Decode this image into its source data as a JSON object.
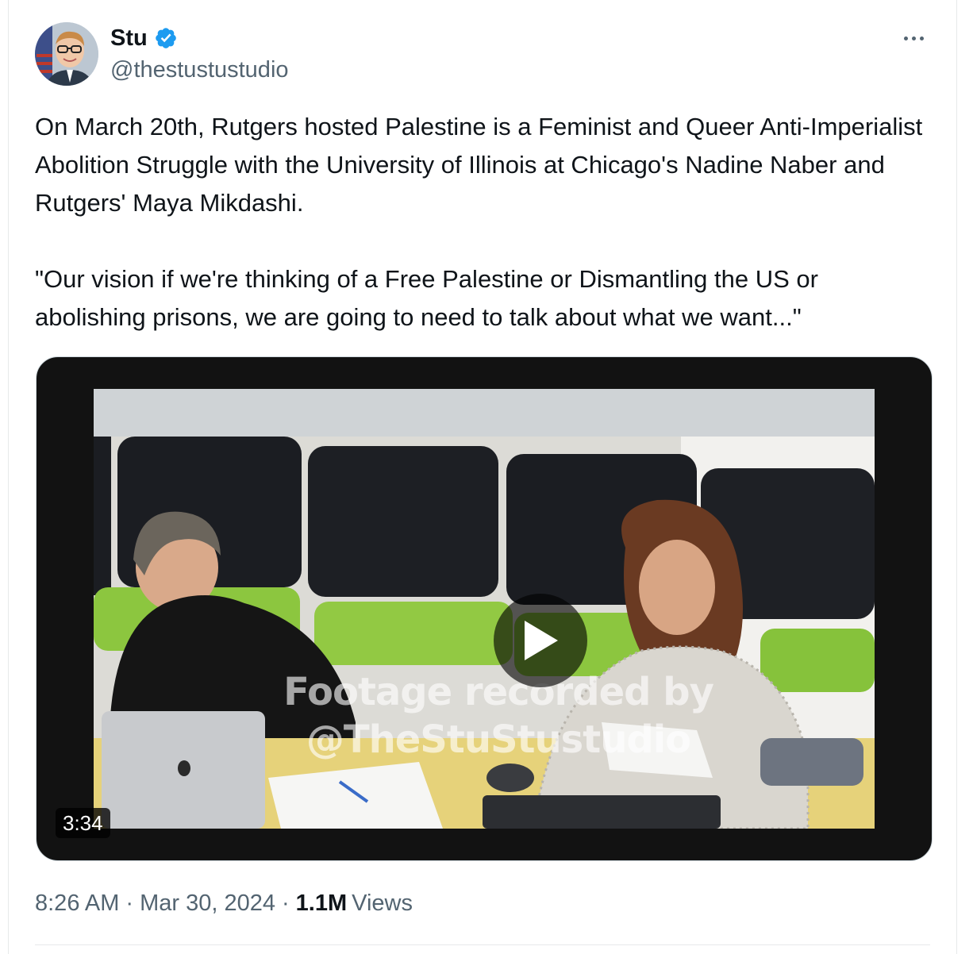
{
  "author": {
    "display_name": "Stu",
    "handle": "@thestustustudio",
    "verified": true,
    "verified_color": "#1d9bf0"
  },
  "tweet": {
    "paragraphs": [
      "On March 20th, Rutgers hosted Palestine is a Feminist and Queer Anti-Imperialist Abolition Struggle with the University of Illinois at Chicago's Nadine Naber and Rutgers' Maya Mikdashi.",
      "\"Our vision if we're thinking of a Free Palestine or Dismantling the US or abolishing prisons, we are going to need to talk about what we want...\""
    ]
  },
  "media": {
    "duration": "3:34",
    "watermark_line1": "Footage recorded by",
    "watermark_line2": "@TheStuStustudio",
    "play_icon": "play-icon"
  },
  "meta": {
    "time": "8:26 AM",
    "date": "Mar 30, 2024",
    "separator": "·",
    "views_count": "1.1M",
    "views_label": "Views"
  },
  "icons": {
    "more": "more-horizontal-icon",
    "verified": "verified-badge-icon"
  }
}
